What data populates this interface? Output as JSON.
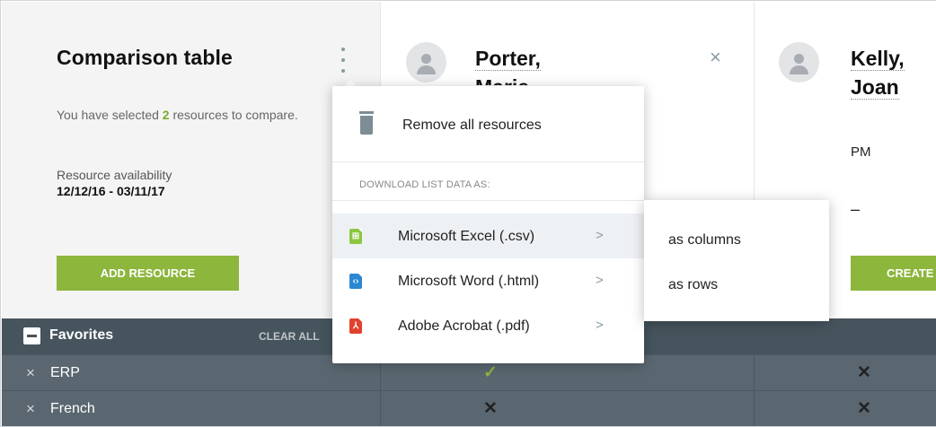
{
  "panel": {
    "title": "Comparison table",
    "selected_prefix": "You have selected ",
    "selected_count": "2",
    "selected_suffix": " resources to compare.",
    "availability_label": "Resource availability",
    "availability_dates": "12/12/16 - 03/11/17",
    "add_button": "ADD RESOURCE",
    "menu_icon": "kebab-menu-icon"
  },
  "resources": [
    {
      "name_line1": "Porter,",
      "name_line2": "Marie",
      "close": "×"
    },
    {
      "name_line1": "Kelly,",
      "name_line2": "Joan",
      "role": "PM",
      "value": "–",
      "button": "CREATE"
    }
  ],
  "menu": {
    "remove_label": "Remove all resources",
    "section_label": "DOWNLOAD LIST DATA AS:",
    "options": [
      {
        "label": "Microsoft Excel (.csv)",
        "icon": "excel-file-icon",
        "glyph": "⊞",
        "color": "#8cc63f",
        "chevron": ">"
      },
      {
        "label": "Microsoft Word (.html)",
        "icon": "word-file-icon",
        "glyph": "‹›",
        "color": "#2b87d1",
        "chevron": ">"
      },
      {
        "label": "Adobe Acrobat (.pdf)",
        "icon": "pdf-file-icon",
        "glyph": "⅄",
        "color": "#e1412d",
        "chevron": ">"
      }
    ],
    "submenu": [
      "as columns",
      "as rows"
    ]
  },
  "favorites": {
    "label": "Favorites",
    "clear_all": "CLEAR ALL",
    "rows": [
      {
        "label": "ERP",
        "remove": "×",
        "values": [
          "✓",
          "✕"
        ]
      },
      {
        "label": "French",
        "remove": "×",
        "values": [
          "✕",
          "✕"
        ]
      }
    ]
  },
  "colors": {
    "accent_green": "#8cb63c",
    "dark_bar": "#46545d",
    "row_bg": "#5a6770"
  }
}
